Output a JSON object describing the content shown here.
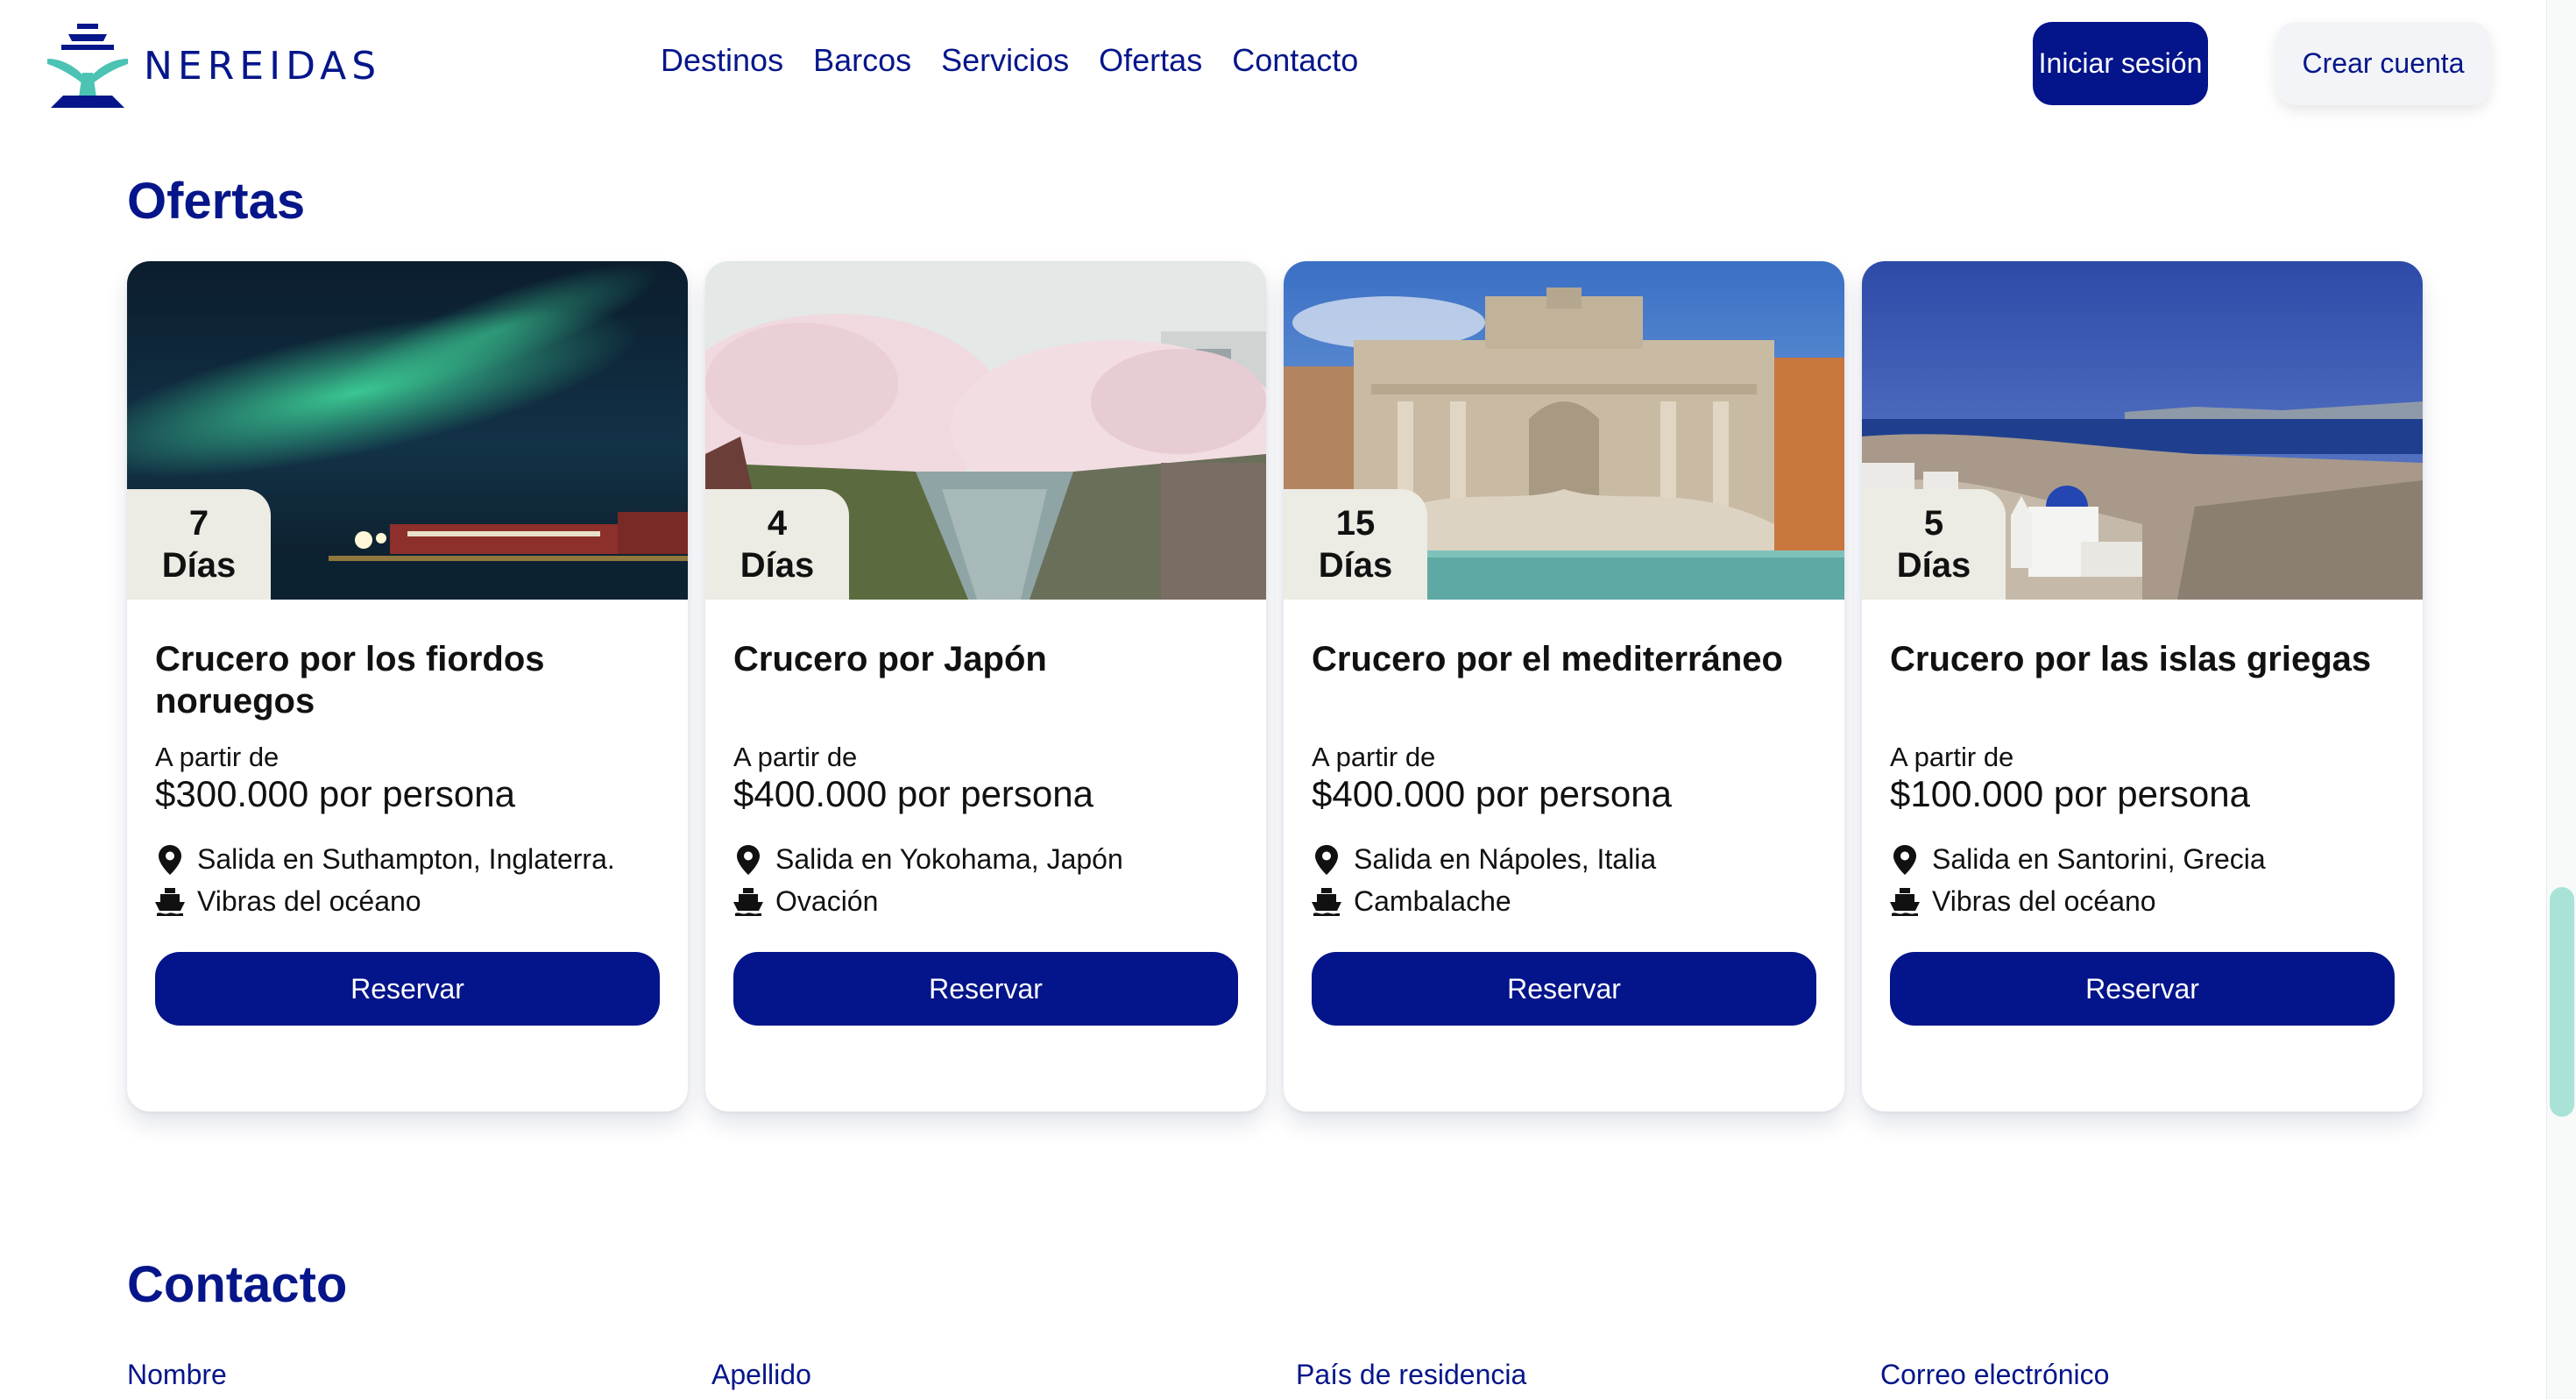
{
  "brand": {
    "name": "NEREIDAS",
    "logo_icon": "ship-whale-tail-logo"
  },
  "nav": [
    {
      "label": "Destinos"
    },
    {
      "label": "Barcos"
    },
    {
      "label": "Servicios"
    },
    {
      "label": "Ofertas"
    },
    {
      "label": "Contacto"
    }
  ],
  "auth": {
    "login": "Iniciar sesión",
    "register": "Crear cuenta"
  },
  "offers": {
    "title": "Ofertas",
    "cards": [
      {
        "days_number": "7",
        "days_label": "Días",
        "title": "Crucero por los fiordos noruegos",
        "from_label": "A partir de",
        "price": "$300.000 por persona",
        "departure": "Salida en Suthampton, Inglaterra.",
        "ship": "Vibras del océano",
        "button": "Reservar",
        "image": "northern-lights-harbor"
      },
      {
        "days_number": "4",
        "days_label": "Días",
        "title": "Crucero por Japón",
        "from_label": "A partir de",
        "price": "$400.000 por persona",
        "departure": "Salida en Yokohama, Japón",
        "ship": "Ovación",
        "button": "Reservar",
        "image": "cherry-blossom-canal"
      },
      {
        "days_number": "15",
        "days_label": "Días",
        "title": "Crucero por el mediterráneo",
        "from_label": "A partir de",
        "price": "$400.000 por persona",
        "departure": "Salida en Nápoles, Italia",
        "ship": "Cambalache",
        "button": "Reservar",
        "image": "trevi-fountain"
      },
      {
        "days_number": "5",
        "days_label": "Días",
        "title": "Crucero por las islas griegas",
        "from_label": "A partir de",
        "price": "$100.000 por persona",
        "departure": "Salida en Santorini, Grecia",
        "ship": "Vibras del océano",
        "button": "Reservar",
        "image": "santorini-village"
      }
    ]
  },
  "contact": {
    "title": "Contacto",
    "fields": [
      {
        "label": "Nombre"
      },
      {
        "label": "Apellido"
      },
      {
        "label": "País de residencia"
      },
      {
        "label": "Correo electrónico"
      }
    ]
  },
  "icons": {
    "location": "map-pin-icon",
    "ship": "ship-icon"
  },
  "colors": {
    "primary": "#04148a",
    "secondary_button": "#f2f4f8",
    "days_badge": "#ecebe4",
    "scroll_thumb": "#a9e3d8"
  }
}
